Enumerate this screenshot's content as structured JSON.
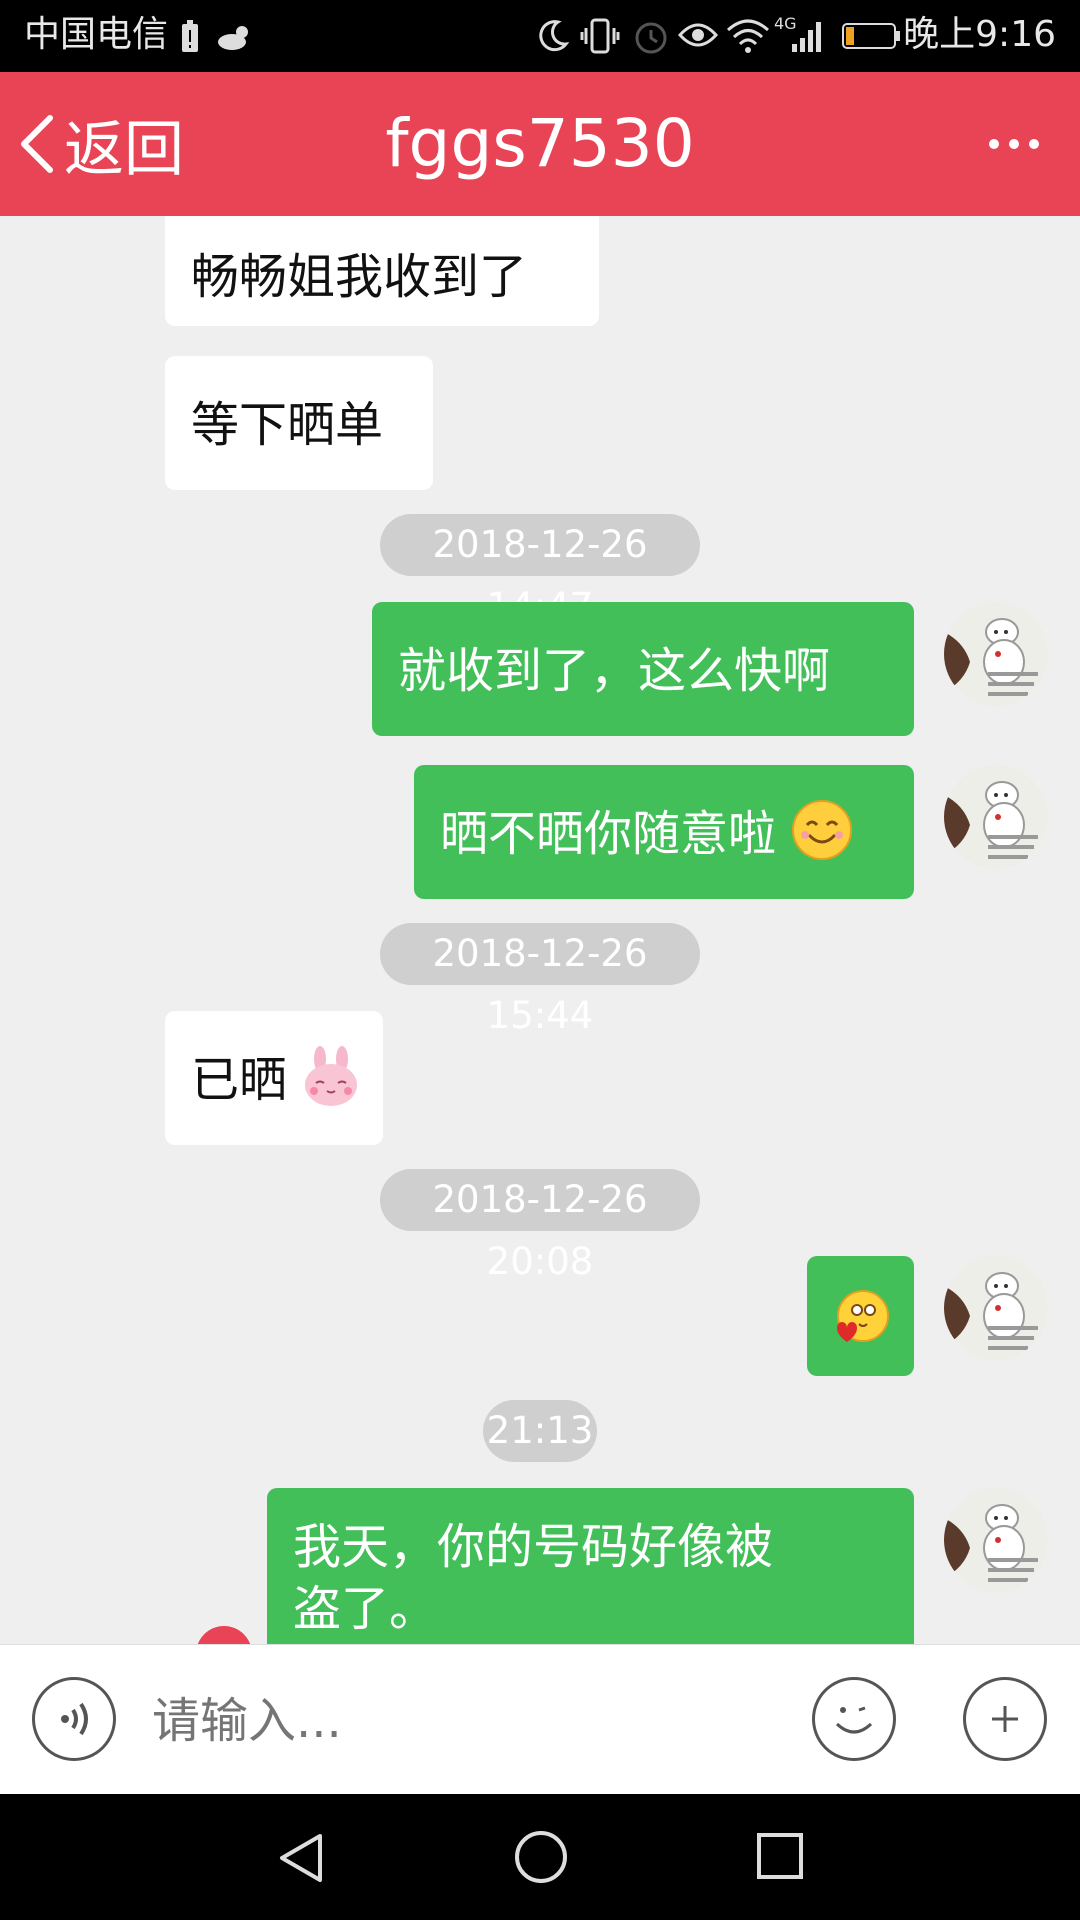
{
  "status_bar": {
    "carrier": "中国电信",
    "time": "晚上9:16",
    "network": "4G"
  },
  "header": {
    "back_label": "返回",
    "title": "fggs7530"
  },
  "messages": [
    {
      "type": "in",
      "text": "畅畅姐我收到了"
    },
    {
      "type": "in",
      "text": "等下晒单"
    },
    {
      "type": "timestamp",
      "text": "2018-12-26 14:47"
    },
    {
      "type": "out",
      "text": "就收到了，这么快啊"
    },
    {
      "type": "out",
      "text": "晒不晒你随意啦",
      "emoji": "smile-emoji"
    },
    {
      "type": "timestamp",
      "text": "2018-12-26 15:44"
    },
    {
      "type": "in",
      "text": "已晒",
      "emoji": "pink-bunny-emoji"
    },
    {
      "type": "timestamp",
      "text": "2018-12-26 20:08"
    },
    {
      "type": "out",
      "text": "",
      "emoji": "heart-face-emoji"
    },
    {
      "type": "timestamp",
      "text": "21:13"
    },
    {
      "type": "out",
      "text_line1": "我天，你的号码好像被",
      "text_line2": "盗了。"
    }
  ],
  "avatar_text": {
    "line1": "加油！",
    "line2": "你比你想像",
    "line3": "更有力量"
  },
  "input_bar": {
    "placeholder": "请输入..."
  },
  "colors": {
    "header": "#e94455",
    "outgoing_bubble": "#43bf5a",
    "incoming_bubble": "#ffffff",
    "background": "#efefef",
    "timestamp_pill": "#cfcfcf"
  },
  "icons": [
    "back-chevron-icon",
    "more-icon",
    "voice-icon",
    "emoji-icon",
    "plus-icon",
    "nav-back-icon",
    "nav-home-icon",
    "nav-recents-icon"
  ]
}
